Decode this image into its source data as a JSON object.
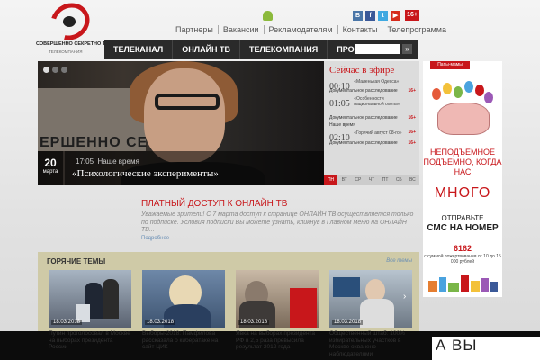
{
  "logo": {
    "name": "СОВЕРШЕННО СЕКРЕТНО TV",
    "sub": "ТЕЛЕКОМПАНИЯ"
  },
  "toplinks": [
    "Партнеры",
    "Вакансии",
    "Рекламодателям",
    "Контакты",
    "Телепрограмма"
  ],
  "age_rating": "16+",
  "social": [
    "vk-icon",
    "facebook-icon",
    "twitter-icon",
    "youtube-icon"
  ],
  "nav": [
    "ТЕЛЕКАНАЛ",
    "ОНЛАЙН ТВ",
    "ТЕЛЕКОМПАНИЯ",
    "ПРОГРАММЫ"
  ],
  "search": {
    "placeholder": "",
    "button": "»"
  },
  "video": {
    "sign_text": "ЕРШЕННО СЕ",
    "day": "20",
    "month": "марта",
    "time": "17:05",
    "program": "Наше время",
    "title": "«Психологические эксперименты»"
  },
  "schedule": {
    "heading": "Сейчас в эфире",
    "rows": [
      {
        "time": "00:10",
        "text": "«Маленькая Одесса»",
        "rating": ""
      },
      {
        "category": "Документальное расследование",
        "rating": "16+"
      },
      {
        "time": "01:05",
        "text": "«Особенности национальной охоты»",
        "rating": ""
      },
      {
        "category": "Документальное расследование",
        "rating": "16+"
      },
      {
        "category": "Наше время"
      },
      {
        "time": "02:10",
        "text": "«Горячий август 08-го»",
        "rating": "16+"
      },
      {
        "category": "Документальное расследование",
        "rating": "16+"
      }
    ],
    "days": [
      "ПН",
      "ВТ",
      "СР",
      "ЧТ",
      "ПТ",
      "СБ",
      "ВС"
    ]
  },
  "ad": {
    "tag": "Папы-мамы",
    "line1": "НЕПОДЪЁМНОЕ ПОДЪЕМНО, КОГДА НАС",
    "line2": "МНОГО",
    "line3": "ОТПРАВЬТЕ",
    "line4": "СМС НА НОМЕР",
    "line5": "6162",
    "line6": "с суммой пожертвования от 10 до 15 000 рублей"
  },
  "paid": {
    "title": "ПЛАТНЫЙ ДОСТУП К ОНЛАЙН ТВ",
    "body": "Уважаемые зрители! С 7 марта доступ к странице ОНЛАЙН ТВ осуществляется только по подписке. Условия подписки Вы можете узнать, кликнув в Главном меню на ОНЛАЙН ТВ...",
    "more": "Подробнее"
  },
  "hot": {
    "title": "ГОРЯЧИЕ ТЕМЫ",
    "all": "Все темы",
    "cards": [
      {
        "date": "18.03.2018",
        "caption": "Путин проголосовал в Москве на выборах президента России"
      },
      {
        "date": "18.03.2018",
        "caption": "Выборы-2018: Памфилова рассказала о кибератаке на сайт ЦИК"
      },
      {
        "date": "18.03.2018",
        "caption": "Явка на выборах президента РФ в 2,5 раза превысила результат 2012 года"
      },
      {
        "date": "18.03.2018",
        "caption": "Общественный штаб: 100% избирательных участков в Москве охвачено наблюдателями"
      }
    ]
  },
  "bottom_text": "А ВЫ",
  "colors": {
    "accent": "#c8171b",
    "nav": "#2a2a2a",
    "hot_bg": "#cfcaa7"
  }
}
